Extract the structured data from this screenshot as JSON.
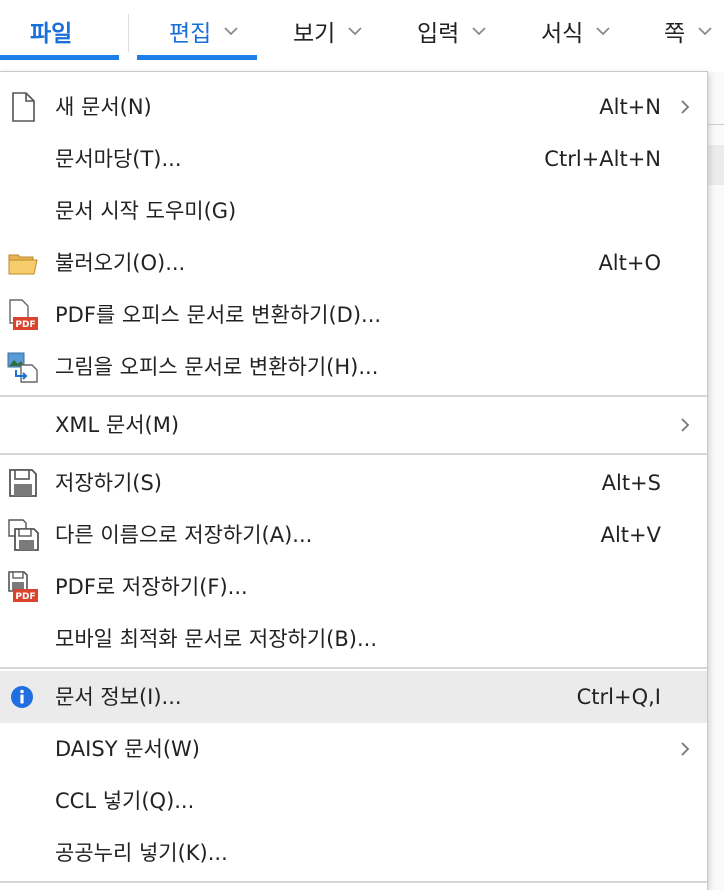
{
  "menubar": {
    "tabs": [
      {
        "label": "파일"
      },
      {
        "label": "편집"
      },
      {
        "label": "보기"
      },
      {
        "label": "입력"
      },
      {
        "label": "서식"
      },
      {
        "label": "쪽"
      }
    ],
    "active_tab": "파일",
    "accent_color": "#1f7ee8"
  },
  "file_menu": {
    "items": [
      {
        "label": "새 문서(N)",
        "shortcut": "Alt+N",
        "icon": "new-document-icon",
        "submenu": true
      },
      {
        "label": "문서마당(T)...",
        "shortcut": "Ctrl+Alt+N"
      },
      {
        "label": "문서 시작 도우미(G)"
      },
      {
        "label": "불러오기(O)...",
        "shortcut": "Alt+O",
        "icon": "folder-open-icon"
      },
      {
        "label": "PDF를 오피스 문서로 변환하기(D)...",
        "icon": "pdf-convert-icon"
      },
      {
        "label": "그림을 오피스 문서로 변환하기(H)...",
        "icon": "image-convert-icon"
      },
      {
        "label": "XML 문서(M)",
        "submenu": true
      },
      {
        "label": "저장하기(S)",
        "shortcut": "Alt+S",
        "icon": "save-icon"
      },
      {
        "label": "다른 이름으로 저장하기(A)...",
        "shortcut": "Alt+V",
        "icon": "save-as-icon"
      },
      {
        "label": "PDF로 저장하기(F)...",
        "icon": "save-pdf-icon"
      },
      {
        "label": "모바일 최적화 문서로 저장하기(B)..."
      },
      {
        "label": "문서 정보(I)...",
        "shortcut": "Ctrl+Q,I",
        "icon": "info-icon",
        "highlighted": true
      },
      {
        "label": "DAISY 문서(W)",
        "submenu": true
      },
      {
        "label": "CCL 넣기(Q)..."
      },
      {
        "label": "공공누리 넣기(K)..."
      }
    ]
  }
}
